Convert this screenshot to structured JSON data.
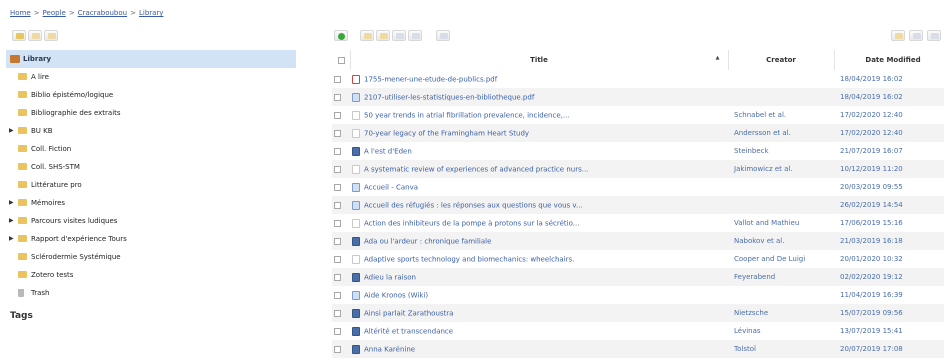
{
  "breadcrumb": {
    "items": [
      "Home",
      "People",
      "Cracraboubou",
      "Library"
    ],
    "separator": ">"
  },
  "library": {
    "items": [
      {
        "label": "Library",
        "icon": "library-icon",
        "selected": true,
        "expandable": false
      },
      {
        "label": "A lire",
        "icon": "folder-icon",
        "selected": false,
        "expandable": false
      },
      {
        "label": "Biblio épistémo/logique",
        "icon": "folder-icon",
        "selected": false,
        "expandable": false
      },
      {
        "label": "Bibliographie des extraits",
        "icon": "folder-icon",
        "selected": false,
        "expandable": false
      },
      {
        "label": "BU KB",
        "icon": "folder-icon",
        "selected": false,
        "expandable": true
      },
      {
        "label": "Coll. Fiction",
        "icon": "folder-icon",
        "selected": false,
        "expandable": false
      },
      {
        "label": "Coll. SHS-STM",
        "icon": "folder-icon",
        "selected": false,
        "expandable": false
      },
      {
        "label": "Littérature pro",
        "icon": "folder-icon",
        "selected": false,
        "expandable": false
      },
      {
        "label": "Mémoires",
        "icon": "folder-icon",
        "selected": false,
        "expandable": true
      },
      {
        "label": "Parcours visites ludiques",
        "icon": "folder-icon",
        "selected": false,
        "expandable": true
      },
      {
        "label": "Rapport d'expérience Tours",
        "icon": "folder-icon",
        "selected": false,
        "expandable": true
      },
      {
        "label": "Sclérodermie Systémique",
        "icon": "folder-icon",
        "selected": false,
        "expandable": false
      },
      {
        "label": "Zotero tests",
        "icon": "folder-icon",
        "selected": false,
        "expandable": false
      },
      {
        "label": "Trash",
        "icon": "trash-icon",
        "selected": false,
        "expandable": false
      }
    ],
    "expander_glyph": "▶",
    "tags_heading": "Tags"
  },
  "items_table": {
    "columns": {
      "title": "Title",
      "creator": "Creator",
      "date": "Date Modified"
    },
    "sort_indicator": "▲",
    "rows": [
      {
        "icon": "pdf",
        "title": "1755-mener-une-etude-de-publics.pdf",
        "creator": "",
        "date": "18/04/2019 16:02"
      },
      {
        "icon": "web",
        "title": "2107-utiliser-les-statistiques-en-bibliotheque.pdf",
        "creator": "",
        "date": "18/04/2019 16:02"
      },
      {
        "icon": "journal",
        "title": "50 year trends in atrial fibrillation prevalence, incidence,...",
        "creator": "Schnabel et al.",
        "date": "17/02/2020 12:40"
      },
      {
        "icon": "journal",
        "title": "70-year legacy of the Framingham Heart Study",
        "creator": "Andersson et al.",
        "date": "17/02/2020 12:40"
      },
      {
        "icon": "book",
        "title": "A l'est d'Eden",
        "creator": "Steinbeck",
        "date": "21/07/2019 16:07"
      },
      {
        "icon": "journal",
        "title": "A systematic review of experiences of advanced practice nurs...",
        "creator": "Jakimowicz et al.",
        "date": "10/12/2019 11:20"
      },
      {
        "icon": "web",
        "title": "Accueil - Canva",
        "creator": "",
        "date": "20/03/2019 09:55"
      },
      {
        "icon": "web",
        "title": "Accueil des réfugiés : les réponses aux questions que vous v...",
        "creator": "",
        "date": "26/02/2019 14:54"
      },
      {
        "icon": "journal",
        "title": "Action des inhibiteurs de la pompe à protons sur la sécrétio...",
        "creator": "Vallot and Mathieu",
        "date": "17/06/2019 15:16"
      },
      {
        "icon": "book",
        "title": "Ada ou l'ardeur : chronique familiale",
        "creator": "Nabokov et al.",
        "date": "21/03/2019 16:18"
      },
      {
        "icon": "journal",
        "title": "Adaptive sports technology and biomechanics: wheelchairs.",
        "creator": "Cooper and De Luigi",
        "date": "20/01/2020 10:32"
      },
      {
        "icon": "book",
        "title": "Adieu la raison",
        "creator": "Feyerabend",
        "date": "02/02/2020 19:12"
      },
      {
        "icon": "web",
        "title": "Aide Kronos (Wiki)",
        "creator": "",
        "date": "11/04/2019 16:39"
      },
      {
        "icon": "book",
        "title": "Ainsi parlait Zarathoustra",
        "creator": "Nietzsche",
        "date": "15/07/2019 09:56"
      },
      {
        "icon": "book",
        "title": "Altérité et transcendance",
        "creator": "Lévinas",
        "date": "13/07/2019 15:41"
      },
      {
        "icon": "book",
        "title": "Anna Karénine",
        "creator": "Tolstoï",
        "date": "20/07/2019 17:08"
      }
    ]
  }
}
